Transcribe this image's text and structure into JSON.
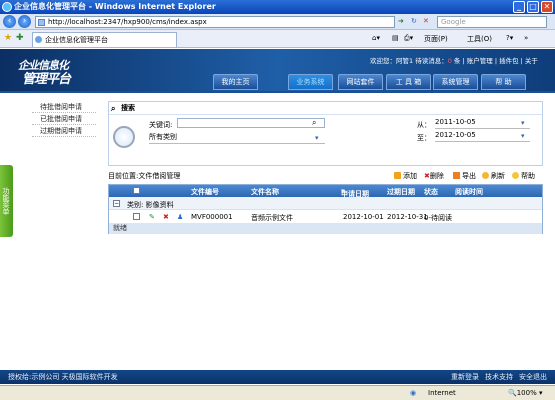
{
  "window": {
    "title": "企业信息化管理平台 - Windows Internet Explorer",
    "min": "_",
    "max": "□",
    "close": "✕"
  },
  "browser": {
    "url": "http://localhost:2347/hxp900/cms/index.aspx",
    "search_placeholder": "Google",
    "tab_title": "企业信息化管理平台",
    "page_menu": "页面(P)",
    "tools_menu": "工具(O)"
  },
  "header": {
    "logo_line1": "企业信息化",
    "logo_line2": "管理平台",
    "welcome": "欢迎您：阿管1 待读消息：",
    "msg_count": "0",
    "msg_unit": "条",
    "links": [
      "账户管理",
      "插件包",
      "关于"
    ],
    "nav": [
      "我的主页",
      "业务系统",
      "网站套件",
      "工 具 箱",
      "系统管理",
      "帮 助"
    ],
    "active_nav": 1
  },
  "sidebar": {
    "items": [
      "待批借阅申请",
      "已批借阅申请",
      "过期借阅申请"
    ],
    "vtab": "功能菜单"
  },
  "search": {
    "title": "搜索",
    "kw_label": "关键词:",
    "kw_value": "",
    "category": "所有类别",
    "from_label": "从：",
    "from_date": "2011-10-05",
    "to_label": "至：",
    "to_date": "2012-10-05"
  },
  "location": "目前位置:文件借阅管理",
  "toolbar": {
    "add": "添加",
    "delete": "删除",
    "export": "导出",
    "refresh": "刷新",
    "help": "帮助"
  },
  "table": {
    "columns": [
      "文件编号",
      "文件名称",
      "申请日期",
      "过期日期",
      "状态",
      "阅读时间"
    ],
    "group": "类别: 影像资料",
    "rows": [
      {
        "code": "MVF000001",
        "name": "音频示例文件",
        "apply": "2012-10-01",
        "expire": "2012-10-31",
        "status": "0-待阅读",
        "read": ""
      }
    ],
    "footer": "就绪"
  },
  "footer": {
    "left": "授权给:示例公司   天极国际软件开发",
    "right": [
      "重新登录",
      "技术支持",
      "安全退出"
    ]
  },
  "status": {
    "zone": "Internet",
    "zoom": "100%"
  }
}
